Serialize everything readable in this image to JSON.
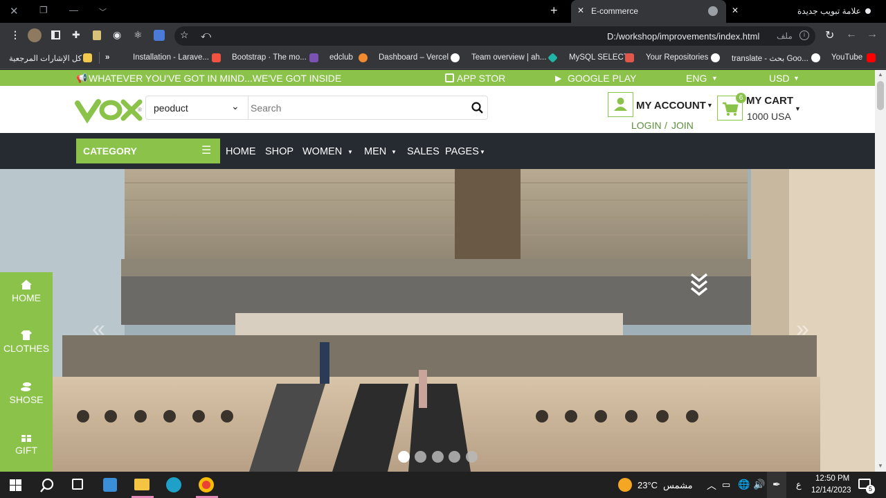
{
  "browser": {
    "tabs": [
      {
        "title": "E-commerce",
        "active": true
      },
      {
        "title": "علامة تبويب جديدة",
        "active": false
      }
    ],
    "address_prefix": "ملف",
    "url": "D:/workshop/improvements/index.html",
    "bookmarks": [
      "Installation - Larave...",
      "Bootstrap · The mo...",
      "edclub",
      "Dashboard – Vercel",
      "Team overview | ah...",
      "MySQL SELECT",
      "Your Repositories",
      "translate - بحث Goo...",
      "YouTube"
    ],
    "all_bookmarks": "كل الإشارات المرجعية",
    "more": "»"
  },
  "site": {
    "top_strip": {
      "tagline": "WHATEVER YOU'VE GOT IN MIND...WE'VE GOT INSIDE",
      "app_store": "APP STOR",
      "google_play": "GOOGLE PLAY",
      "language": "ENG",
      "currency": "USD"
    },
    "logo": "VOX",
    "search": {
      "category": "peoduct",
      "placeholder": "Search"
    },
    "account": {
      "title": "MY ACCOUNT",
      "login": "LOGIN",
      "sep": "/",
      "join": "JOIN"
    },
    "cart": {
      "title": "MY CART",
      "count": "6",
      "total": "1000 USA"
    },
    "nav": {
      "category": "CATEGORY",
      "items": [
        "HOME",
        "SHOP",
        "WOMEN",
        "MEN",
        "SALES",
        "PAGES"
      ]
    },
    "side_categories": [
      "HOME",
      "CLOTHES",
      "SHOSE",
      "GIFT"
    ],
    "carousel": {
      "slides": 5,
      "active": 0
    },
    "colors": {
      "brand": "#8bc34a",
      "nav_bg": "#262a31"
    }
  },
  "taskbar": {
    "weather_temp": "23°C",
    "weather_text": "مشمس",
    "lang": "ع",
    "time": "12:50 PM",
    "date": "12/14/2023",
    "notifications": "5"
  }
}
